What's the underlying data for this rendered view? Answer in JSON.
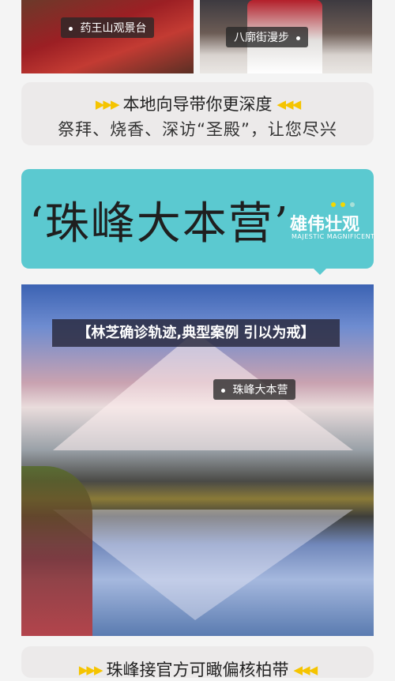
{
  "top_photos": {
    "left_label": "药王山观景台",
    "right_label": "八廓街漫步"
  },
  "guide_card": {
    "line1": "本地向导带你更深度",
    "line2": "祭拜、烧香、深访“圣殿”，让您尽兴",
    "arrow_left": "▶▶▶",
    "arrow_right": "◀◀◀"
  },
  "banner": {
    "title": "‘珠峰大本营’",
    "subtitle": "雄伟壮观",
    "subtitle_en": "MAJESTIC MAGNIFICENT",
    "color": "#5bc9d0",
    "dot_colors": [
      "#f5d800",
      "#f5d800",
      "#a8e0d8"
    ]
  },
  "mountain_photo": {
    "overlay_title": "【林芝确诊轨迹,典型案例 引以为戒】",
    "location_label": "珠峰大本营"
  },
  "bottom_card": {
    "line": "珠峰接官方可瞰偏核柏带"
  }
}
